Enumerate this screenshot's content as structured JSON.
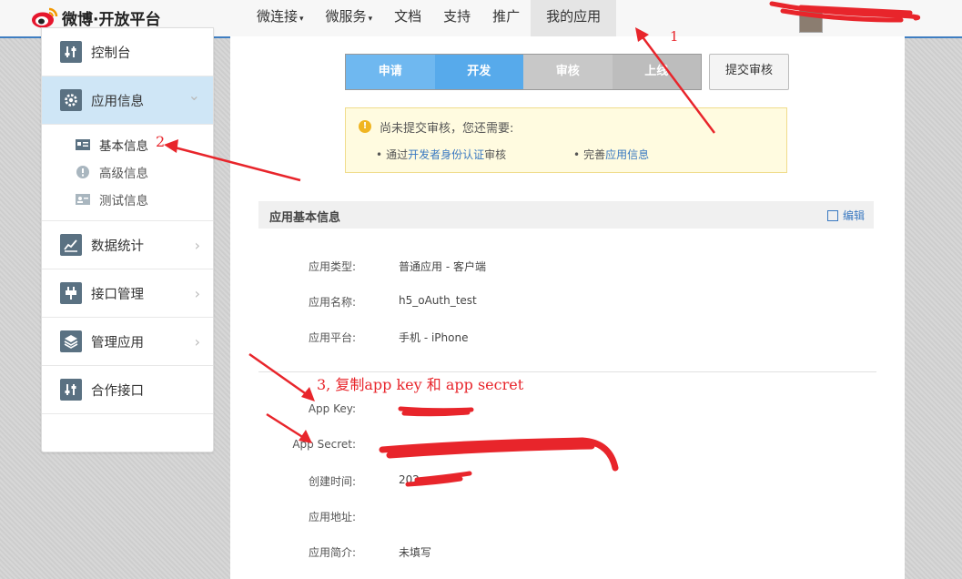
{
  "header": {
    "logo_text": "微博·开放平台",
    "nav": [
      {
        "label": "微连接",
        "has_dropdown": true
      },
      {
        "label": "微服务",
        "has_dropdown": true
      },
      {
        "label": "文档",
        "has_dropdown": false
      },
      {
        "label": "支持",
        "has_dropdown": false
      },
      {
        "label": "推广",
        "has_dropdown": false
      },
      {
        "label": "我的应用",
        "has_dropdown": false,
        "active": true
      }
    ],
    "dropdown_caret": "▾"
  },
  "sidebar": {
    "items": [
      {
        "label": "控制台",
        "icon": "sliders-icon"
      },
      {
        "label": "应用信息",
        "icon": "gear-icon",
        "active": true,
        "expanded": true
      },
      {
        "label": "数据统计",
        "icon": "chart-icon"
      },
      {
        "label": "接口管理",
        "icon": "plug-icon"
      },
      {
        "label": "管理应用",
        "icon": "layers-icon"
      },
      {
        "label": "合作接口",
        "icon": "sliders-icon"
      }
    ],
    "sub_items": [
      {
        "label": "基本信息",
        "icon": "card-icon",
        "active": true
      },
      {
        "label": "高级信息",
        "icon": "info-icon"
      },
      {
        "label": "测试信息",
        "icon": "user-card-icon"
      }
    ],
    "arrow_right": "›",
    "arrow_down": "⌄"
  },
  "steps": [
    "申请",
    "开发",
    "审核",
    "上线"
  ],
  "submit_button": "提交审核",
  "notice": {
    "title": "尚未提交审核，您还需要:",
    "item1_prefix": "通过",
    "item1_link": "开发者身份认证",
    "item1_suffix": "审核",
    "item2_prefix": "完善",
    "item2_link": "应用信息",
    "bullet": "•",
    "warn_glyph": "!"
  },
  "section": {
    "title": "应用基本信息",
    "edit_label": "编辑"
  },
  "fields": [
    {
      "key": "应用类型:",
      "value": "普通应用  -  客户端"
    },
    {
      "key": "应用名称:",
      "value": "h5_oAuth_test"
    },
    {
      "key": "应用平台:",
      "value": "手机  -  iPhone"
    },
    {
      "key": "App Key:",
      "value": ""
    },
    {
      "key": "App Secret:",
      "value": ""
    },
    {
      "key": "创建时间:",
      "value": "202"
    },
    {
      "key": "应用地址:",
      "value": ""
    },
    {
      "key": "应用简介:",
      "value": "未填写"
    }
  ],
  "annotations": {
    "label1": "1",
    "label2": "2",
    "label3": "3, 复制app key 和 app secret",
    "color": "#e8252b"
  }
}
